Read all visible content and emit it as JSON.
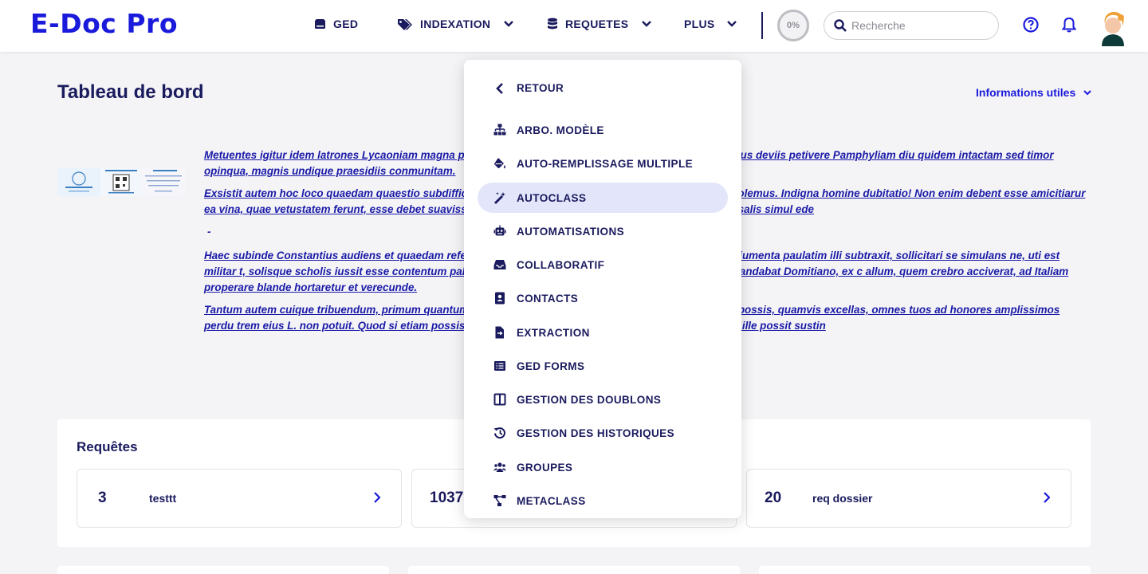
{
  "app": {
    "logo": "E-Doc Pro",
    "colors": {
      "brand": "#1a1adb",
      "navy": "#1a1a5e",
      "active_bg": "#e3e6fa"
    }
  },
  "nav": {
    "ged": "GED",
    "indexation": "INDEXATION",
    "requetes": "REQUETES",
    "plus": "PLUS"
  },
  "header": {
    "progress": "0%",
    "search_placeholder": "Recherche",
    "icons": [
      "help-icon",
      "bell-icon",
      "user-avatar"
    ]
  },
  "page": {
    "title": "Tableau de bord",
    "info_toggle": "Informations utiles"
  },
  "texts": {
    "p1": "Metuentes igitur idem latrones Lycaoniam magna pa  ne stataria documentis frequentibus scirent, tramitibus deviis petivere Pamphyliam diu quidem intactam sed timor  opinqua, magnis undique praesidiis conmunitam.",
    "p2": "Exsistit autem hoc loco quaedam quaestio subdiffici  t anteponendi, ut equis vetulis teneros anteponere solemus. Indigna homine dubitatio! Non enim debent esse amicitiarur  ea vina, quae vetustatem ferunt, esse debet suavissima; verumque illud est, quod dicitur, multos modios salis simul ede",
    "dash": "-",
    "p3": "Haec subinde Constantius audiens et quaedam refer  at lege communi, scribens ad Caesarem blandius adiumenta paulatim illi subtraxit, sollicitari se simulans ne, uti est militar  t, solisque scholis iussit esse contentum palatinis et protectorum cum Scutariis et Gentilibus, et mandabat Domitiano, ex c  allum, quem crebro acciverat, ad Italiam properare blande hortaretur et verecunde.",
    "p4": "Tantum autem cuique tribuendum, primum quantum  diligas atque adiuves, sustinere. Non enim neque tu possis, quamvis excellas, omnes tuos ad honores amplissimos perdu  trem eius L. non potuit. Quod si etiam possis quidvis deferre ad alterum, videndum est tamen, quid ille possit sustin"
  },
  "requetes": {
    "title": "Requêtes",
    "items": [
      {
        "count": "3",
        "label": "testtt"
      },
      {
        "count": "1037",
        "label": ""
      },
      {
        "count": "20",
        "label": "req dossier"
      }
    ]
  },
  "menu": {
    "back": "RETOUR",
    "items": [
      {
        "label": "ARBO. MODÈLE",
        "icon": "sitemap-icon"
      },
      {
        "label": "AUTO-REMPLISSAGE MULTIPLE",
        "icon": "fill-drip-icon"
      },
      {
        "label": "AUTOCLASS",
        "icon": "magic-wand-icon",
        "active": true
      },
      {
        "label": "AUTOMATISATIONS",
        "icon": "robot-icon"
      },
      {
        "label": "COLLABORATIF",
        "icon": "inbox-icon"
      },
      {
        "label": "CONTACTS",
        "icon": "address-book-icon"
      },
      {
        "label": "EXTRACTION",
        "icon": "file-export-icon"
      },
      {
        "label": "GED FORMS",
        "icon": "list-form-icon"
      },
      {
        "label": "GESTION DES DOUBLONS",
        "icon": "columns-icon"
      },
      {
        "label": "GESTION DES HISTORIQUES",
        "icon": "history-icon"
      },
      {
        "label": "GROUPES",
        "icon": "users-icon"
      },
      {
        "label": "METACLASS",
        "icon": "project-diagram-icon"
      }
    ]
  }
}
